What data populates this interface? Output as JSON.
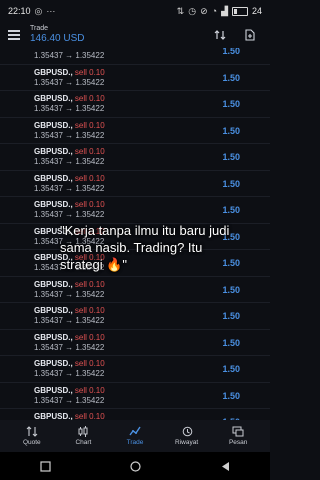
{
  "status_bar": {
    "time": "22:10",
    "extra": "···",
    "battery_percent": "24"
  },
  "header": {
    "title": "Trade",
    "balance": "146.40 USD"
  },
  "first_row": {
    "prices": "1.35437 → 1.35422",
    "profit": "1.50"
  },
  "rows": [
    {
      "symbol": "GBPUSD.,",
      "side": "sell 0.10",
      "prices": "1.35437 → 1.35422",
      "profit": "1.50"
    },
    {
      "symbol": "GBPUSD.,",
      "side": "sell 0.10",
      "prices": "1.35437 → 1.35422",
      "profit": "1.50"
    },
    {
      "symbol": "GBPUSD.,",
      "side": "sell 0.10",
      "prices": "1.35437 → 1.35422",
      "profit": "1.50"
    },
    {
      "symbol": "GBPUSD.,",
      "side": "sell 0.10",
      "prices": "1.35437 → 1.35422",
      "profit": "1.50"
    },
    {
      "symbol": "GBPUSD.,",
      "side": "sell 0.10",
      "prices": "1.35437 → 1.35422",
      "profit": "1.50"
    },
    {
      "symbol": "GBPUSD.,",
      "side": "sell 0.10",
      "prices": "1.35437 → 1.35422",
      "profit": "1.50"
    },
    {
      "symbol": "GBPUSD.,",
      "side": "sell 0.10",
      "prices": "1.35437 → 1.35422",
      "profit": "1.50"
    },
    {
      "symbol": "GBPUSD.,",
      "side": "sell 0.10",
      "prices": "1.35437 → 1.35422",
      "profit": "1.50"
    },
    {
      "symbol": "GBPUSD.,",
      "side": "sell 0.10",
      "prices": "1.35437 → 1.35422",
      "profit": "1.50"
    },
    {
      "symbol": "GBPUSD.,",
      "side": "sell 0.10",
      "prices": "1.35437 → 1.35422",
      "profit": "1.50"
    },
    {
      "symbol": "GBPUSD.,",
      "side": "sell 0.10",
      "prices": "1.35437 → 1.35422",
      "profit": "1.50"
    },
    {
      "symbol": "GBPUSD.,",
      "side": "sell 0.10",
      "prices": "1.35437 → 1.35422",
      "profit": "1.50"
    },
    {
      "symbol": "GBPUSD.,",
      "side": "sell 0.10",
      "prices": "1.35437 → 1.35422",
      "profit": "1.50"
    },
    {
      "symbol": "GBPUSD.,",
      "side": "sell 0.10",
      "prices": "1.35437 → 1.35422",
      "profit": "1.50"
    }
  ],
  "caption": "\"Kerja tanpa ilmu itu baru judi sama nasib. Trading? Itu strategi 🔥\"",
  "nav": {
    "quote": "Quote",
    "chart": "Chart",
    "trade": "Trade",
    "history": "Riwayat",
    "messages": "Pesan"
  },
  "colors": {
    "accent": "#4a90e2",
    "sell": "#e05252",
    "background": "#0d0f14"
  }
}
